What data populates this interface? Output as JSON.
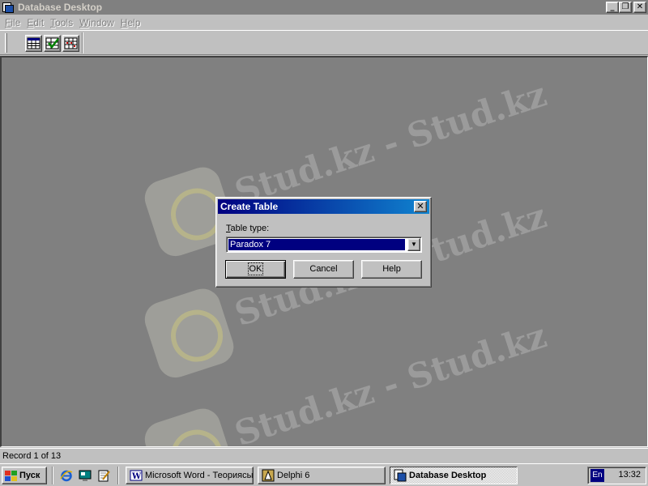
{
  "window": {
    "title": "Database Desktop",
    "caption_buttons": {
      "minimize": "_",
      "restore": "❐",
      "close": "✕"
    }
  },
  "menu": {
    "items": [
      {
        "accel": "F",
        "rest": "ile"
      },
      {
        "accel": "E",
        "rest": "dit"
      },
      {
        "accel": "T",
        "rest": "ools"
      },
      {
        "accel": "W",
        "rest": "indow"
      },
      {
        "accel": "H",
        "rest": "elp"
      }
    ]
  },
  "toolbar": {
    "buttons": [
      "open-table-icon",
      "check-table-icon",
      "open-query-icon"
    ]
  },
  "watermark": {
    "text": "Stud.kz - Stud.kz"
  },
  "dialog": {
    "title": "Create Table",
    "close": "✕",
    "table_type_label_accel": "T",
    "table_type_label_rest": "able type:",
    "table_type_value": "Paradox 7",
    "dropdown_arrow": "▼",
    "ok_label": "OK",
    "cancel_label": "Cancel",
    "help_label": "Help"
  },
  "statusbar": {
    "text": "Record 1 of 13"
  },
  "taskbar": {
    "start_label": "Пуск",
    "quick_launch": [
      "ie-icon",
      "desktop-icon",
      "notepad-icon"
    ],
    "tasks": [
      {
        "label": "Microsoft Word - Теориясы",
        "icon": "word-icon",
        "active": false
      },
      {
        "label": "Delphi 6",
        "icon": "delphi-icon",
        "active": false
      },
      {
        "label": "Database Desktop",
        "icon": "database-desktop-icon",
        "active": true
      }
    ],
    "language": "En",
    "clock": "13:32"
  },
  "colors": {
    "face": "#c0c0c0",
    "workspace": "#808080",
    "dialog_title_start": "#000080",
    "dialog_title_end": "#1084d0",
    "selection": "#000080"
  }
}
